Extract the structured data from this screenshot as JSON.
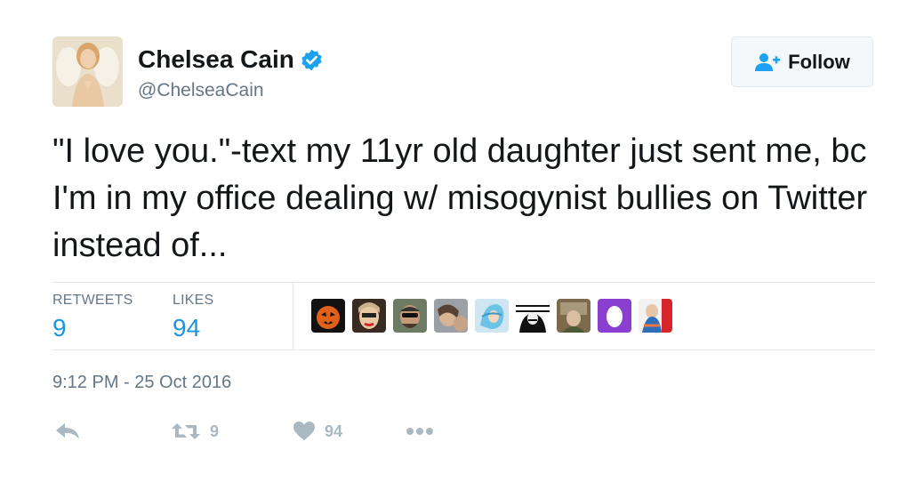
{
  "user": {
    "display_name": "Chelsea Cain",
    "handle": "@ChelseaCain",
    "verified": true
  },
  "follow_button": {
    "label": "Follow",
    "icon": "add-user-icon"
  },
  "tweet": {
    "text": "\"I love you.\"-text my 11yr old daughter just sent me, bc I'm in my office dealing w/ misogynist bullies on Twitter instead of..."
  },
  "stats": {
    "retweets_label": "RETWEETS",
    "retweets_value": "9",
    "likes_label": "LIKES",
    "likes_value": "94"
  },
  "timestamp": "9:12 PM - 25 Oct 2016",
  "actions": {
    "reply_icon": "reply-icon",
    "retweet_icon": "retweet-icon",
    "retweet_count": "9",
    "like_icon": "heart-icon",
    "like_count": "94",
    "more_icon": "more-icon"
  },
  "colors": {
    "text": "#14171a",
    "secondary": "#657786",
    "link_blue": "#1b95e0",
    "verified_blue": "#1da1f2",
    "action_gray": "#aab8c2",
    "border": "#e1e8ed"
  }
}
